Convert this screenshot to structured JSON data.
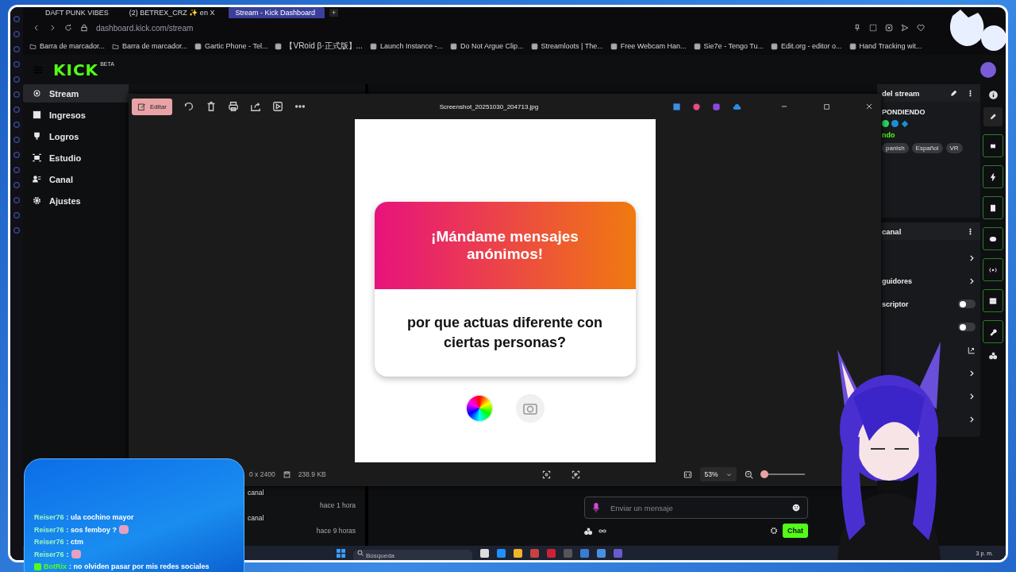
{
  "browser": {
    "tabs": [
      {
        "label": "DAFT PUNK VIBES",
        "selected": false
      },
      {
        "label": "(2) BETREX_CRZ ✨ en X",
        "selected": false
      },
      {
        "label": "Stream - Kick Dashboard",
        "selected": true
      }
    ],
    "new_tab": "+",
    "url": "dashboard.kick.com/stream",
    "bookmarks": [
      "Barra de marcador...",
      "Barra de marcador...",
      "Gartic Phone - Tel...",
      "【VRoid β·正式版】...",
      "Launch Instance -...",
      "Do Not Argue Clip...",
      "Streamloots | The...",
      "Free Webcam Han...",
      "Sie7e - Tengo Tu...",
      "Edit.org - editor o...",
      "Hand Tracking wit..."
    ]
  },
  "dashboard": {
    "logo": "KICK",
    "logo_badge": "BETA",
    "nav": [
      {
        "label": "Stream",
        "selected": true
      },
      {
        "label": "Ingresos",
        "selected": false
      },
      {
        "label": "Logros",
        "selected": false
      },
      {
        "label": "Estudio",
        "selected": false
      },
      {
        "label": "Canal",
        "selected": false
      },
      {
        "label": "Ajustes",
        "selected": false
      }
    ],
    "activity": [
      {
        "label": "canal",
        "time": "hace 1 hora"
      },
      {
        "label": "canal",
        "time": "hace 9 horas"
      }
    ],
    "chat_input": {
      "placeholder": "Enviar un mensaje"
    },
    "chat_button": "Chat",
    "stream_info": {
      "title": "del stream",
      "status": "PONDIENDO",
      "dots": [
        {
          "kind": "dot",
          "color": "#2bdc62"
        },
        {
          "kind": "dot",
          "color": "#1b8fd1"
        },
        {
          "kind": "diamond",
          "color": "#1b8fd1"
        }
      ],
      "category": "ndo",
      "tags": [
        "panish",
        "Español",
        "VR"
      ]
    },
    "channel": {
      "title": "canal",
      "rows": [
        {
          "kind": "link"
        },
        {
          "kind": "link",
          "label": "guidores"
        },
        {
          "kind": "toggle",
          "label": "scriptor",
          "on": false
        },
        {
          "kind": "toggle",
          "on": false
        },
        {
          "kind": "external"
        },
        {
          "kind": "link"
        },
        {
          "kind": "link"
        },
        {
          "kind": "link"
        }
      ]
    }
  },
  "viewer": {
    "title": "Screenshot_20251030_204713.jpg",
    "edit_label": "Editar",
    "image": {
      "heading": "¡Mándame mensajes anónimos!",
      "question": "por que actuas diferente con ciertas personas?"
    },
    "dimensions": "0 x 2400",
    "file_size": "238.9 KB",
    "zoom": "53%",
    "zoom_slider": {
      "level": 0.08
    }
  },
  "chat_overlay": {
    "messages": [
      {
        "kind": "user",
        "user": "Reiser76",
        "text": ": ula cochino mayor",
        "emote": false
      },
      {
        "kind": "user",
        "user": "Reiser76",
        "text": ": sos femboy ?",
        "emote": true
      },
      {
        "kind": "user",
        "user": "Reiser76",
        "text": ": ctm",
        "emote": false
      },
      {
        "kind": "user",
        "user": "Reiser76",
        "text": ":",
        "emote": true
      },
      {
        "kind": "bot",
        "user": "BotRix",
        "text": ": no olviden pasar por mis redes sociales",
        "emote": false
      }
    ]
  },
  "taskbar": {
    "search": {
      "placeholder": "Búsqueda"
    },
    "clock": "3 p. m."
  }
}
